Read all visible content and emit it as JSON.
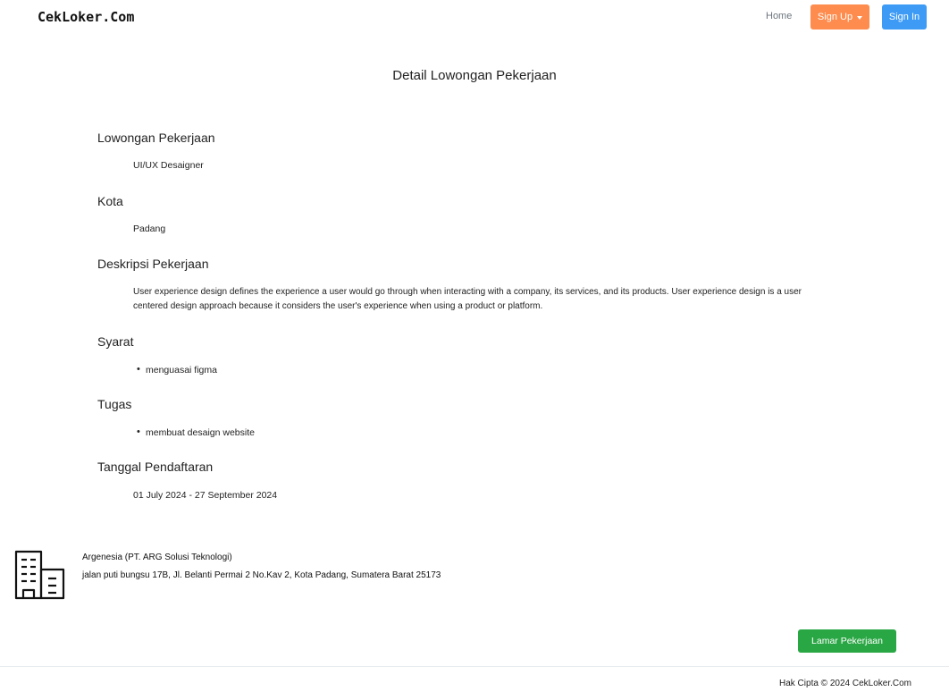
{
  "navbar": {
    "brand": "CekLoker.Com",
    "home": "Home",
    "signup": "Sign Up",
    "signin": "Sign In"
  },
  "page": {
    "title": "Detail Lowongan Pekerjaan"
  },
  "job": {
    "position_label": "Lowongan Pekerjaan",
    "position": "UI/UX Desaigner",
    "city_label": "Kota",
    "city": "Padang",
    "description_label": "Deskripsi Pekerjaan",
    "description": "User experience design defines the experience a user would go through when interacting with a company, its services, and its products. User experience design is a user centered design approach because it considers the user's experience when using a product or platform.",
    "requirements_label": "Syarat",
    "requirements": [
      "menguasai figma"
    ],
    "tasks_label": "Tugas",
    "tasks": [
      "membuat desaign website"
    ],
    "registration_label": "Tanggal Pendaftaran",
    "registration_dates": "01 July 2024 - 27 September 2024"
  },
  "company": {
    "icon": "building-icon",
    "name": "Argenesia (PT. ARG Solusi Teknologi)",
    "address": "jalan puti bungsu 17B, Jl. Belanti Permai 2 No.Kav 2, Kota Padang, Sumatera Barat 25173"
  },
  "actions": {
    "apply": "Lamar Pekerjaan"
  },
  "footer": {
    "copyright": "Hak Cipta © 2024 CekLoker.Com"
  },
  "colors": {
    "signup": "#fd8c4e",
    "signin": "#3d9bf5",
    "apply": "#2aa745"
  }
}
